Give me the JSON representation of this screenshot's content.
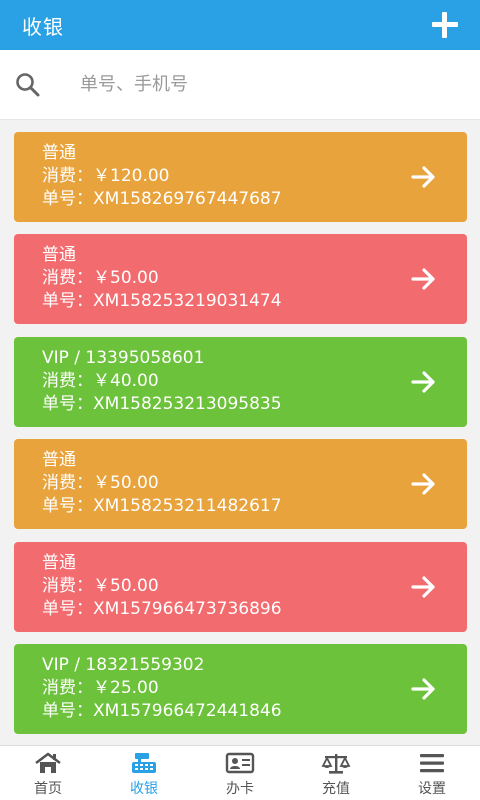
{
  "header": {
    "title": "收银"
  },
  "search": {
    "placeholder": "单号、手机号"
  },
  "orders": [
    {
      "type": "普通",
      "amount": "消费：￥120.00",
      "order_no": "单号：XM158269767447687",
      "color": "#e8a33d"
    },
    {
      "type": "普通",
      "amount": "消费：￥50.00",
      "order_no": "单号：XM158253219031474",
      "color": "#f26b6e"
    },
    {
      "type": "VIP / 13395058601",
      "amount": "消费：￥40.00",
      "order_no": "单号：XM158253213095835",
      "color": "#6cc23a"
    },
    {
      "type": "普通",
      "amount": "消费：￥50.00",
      "order_no": "单号：XM158253211482617",
      "color": "#e8a33d"
    },
    {
      "type": "普通",
      "amount": "消费：￥50.00",
      "order_no": "单号：XM157966473736896",
      "color": "#f26b6e"
    },
    {
      "type": "VIP / 18321559302",
      "amount": "消费：￥25.00",
      "order_no": "单号：XM157966472441846",
      "color": "#6cc23a"
    }
  ],
  "tabs": [
    {
      "label": "首页",
      "icon": "home-icon",
      "active": false
    },
    {
      "label": "收银",
      "icon": "cash-register-icon",
      "active": true
    },
    {
      "label": "办卡",
      "icon": "id-card-icon",
      "active": false
    },
    {
      "label": "充值",
      "icon": "balance-scale-icon",
      "active": false
    },
    {
      "label": "设置",
      "icon": "menu-icon",
      "active": false
    }
  ],
  "colors": {
    "brand": "#2aa0e5",
    "tab_inactive": "#555555"
  }
}
